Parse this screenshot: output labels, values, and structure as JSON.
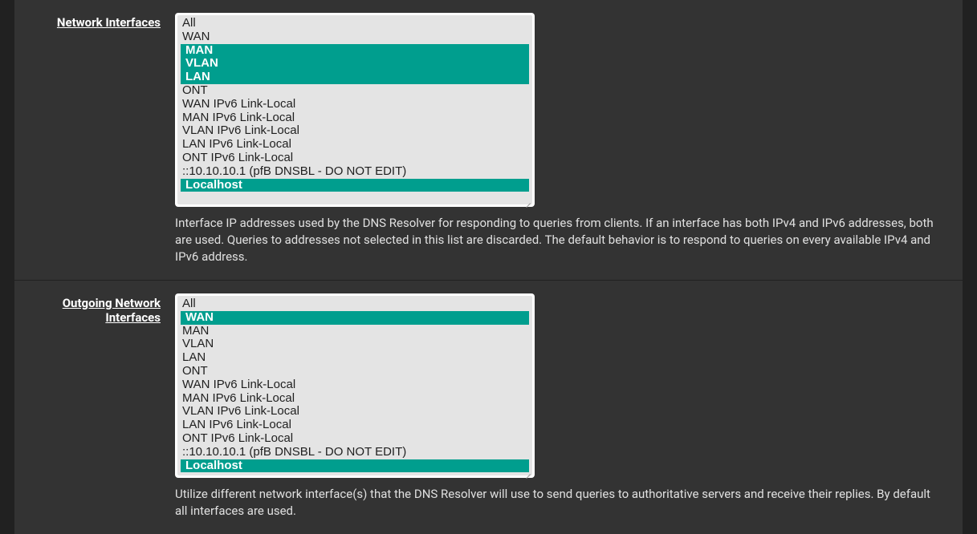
{
  "fields": {
    "network_interfaces": {
      "label": "Network Interfaces",
      "help": "Interface IP addresses used by the DNS Resolver for responding to queries from clients. If an interface has both IPv4 and IPv6 addresses, both are used. Queries to addresses not selected in this list are discarded. The default behavior is to respond to queries on every available IPv4 and IPv6 address.",
      "options": [
        {
          "label": "All",
          "selected": false
        },
        {
          "label": "WAN",
          "selected": false
        },
        {
          "label": "MAN",
          "selected": true
        },
        {
          "label": "VLAN",
          "selected": true
        },
        {
          "label": "LAN",
          "selected": true
        },
        {
          "label": "ONT",
          "selected": false
        },
        {
          "label": "WAN IPv6 Link-Local",
          "selected": false
        },
        {
          "label": "MAN IPv6 Link-Local",
          "selected": false
        },
        {
          "label": "VLAN IPv6 Link-Local",
          "selected": false
        },
        {
          "label": "LAN IPv6 Link-Local",
          "selected": false
        },
        {
          "label": "ONT IPv6 Link-Local",
          "selected": false
        },
        {
          "label": "::10.10.10.1 (pfB DNSBL - DO NOT EDIT)",
          "selected": false
        },
        {
          "label": "Localhost",
          "selected": true
        }
      ]
    },
    "outgoing_interfaces": {
      "label": "Outgoing Network Interfaces",
      "help": "Utilize different network interface(s) that the DNS Resolver will use to send queries to authoritative servers and receive their replies. By default all interfaces are used.",
      "options": [
        {
          "label": "All",
          "selected": false
        },
        {
          "label": "WAN",
          "selected": true
        },
        {
          "label": "MAN",
          "selected": false
        },
        {
          "label": "VLAN",
          "selected": false
        },
        {
          "label": "LAN",
          "selected": false
        },
        {
          "label": "ONT",
          "selected": false
        },
        {
          "label": "WAN IPv6 Link-Local",
          "selected": false
        },
        {
          "label": "MAN IPv6 Link-Local",
          "selected": false
        },
        {
          "label": "VLAN IPv6 Link-Local",
          "selected": false
        },
        {
          "label": "LAN IPv6 Link-Local",
          "selected": false
        },
        {
          "label": "ONT IPv6 Link-Local",
          "selected": false
        },
        {
          "label": "::10.10.10.1 (pfB DNSBL - DO NOT EDIT)",
          "selected": false
        },
        {
          "label": "Localhost",
          "selected": true
        }
      ]
    }
  }
}
